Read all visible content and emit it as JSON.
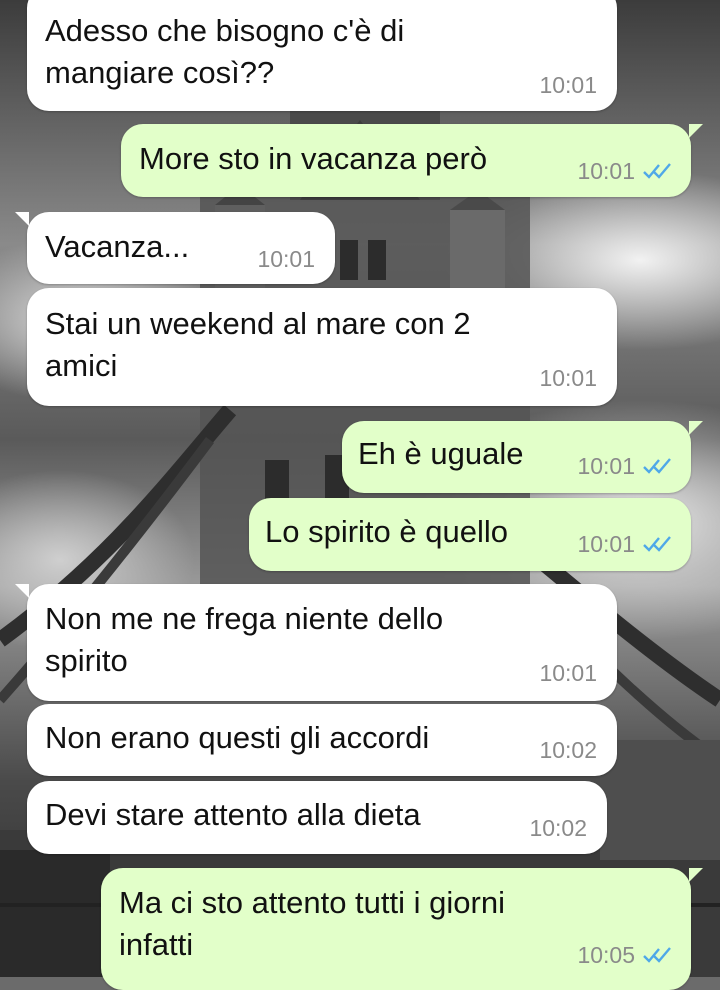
{
  "conversation": {
    "messages": [
      {
        "direction": "in",
        "text": "Adesso che bisogno c'è di\nmangiare così??",
        "time": "10:01"
      },
      {
        "direction": "out",
        "text": "More sto in vacanza però",
        "time": "10:01",
        "status": "read"
      },
      {
        "direction": "in",
        "text": "Vacanza...",
        "time": "10:01"
      },
      {
        "direction": "in",
        "text": "Stai un weekend al mare con 2\namici",
        "time": "10:01"
      },
      {
        "direction": "out",
        "text": "Eh è uguale",
        "time": "10:01",
        "status": "read"
      },
      {
        "direction": "out",
        "text": "Lo spirito è quello",
        "time": "10:01",
        "status": "read"
      },
      {
        "direction": "in",
        "text": "Non me ne frega niente dello\nspirito",
        "time": "10:01"
      },
      {
        "direction": "in",
        "text": "Non erano questi gli accordi",
        "time": "10:02"
      },
      {
        "direction": "in",
        "text": "Devi stare attento alla dieta",
        "time": "10:02"
      },
      {
        "direction": "out",
        "text": "Ma ci sto attento tutti i giorni\ninfatti",
        "time": "10:05",
        "status": "read"
      }
    ]
  },
  "theme": {
    "incoming_bubble": "#ffffff",
    "outgoing_bubble": "#e2ffc9",
    "read_tick_color": "#4fa8e8",
    "wallpaper": "black-and-white photo of Tower Bridge"
  }
}
